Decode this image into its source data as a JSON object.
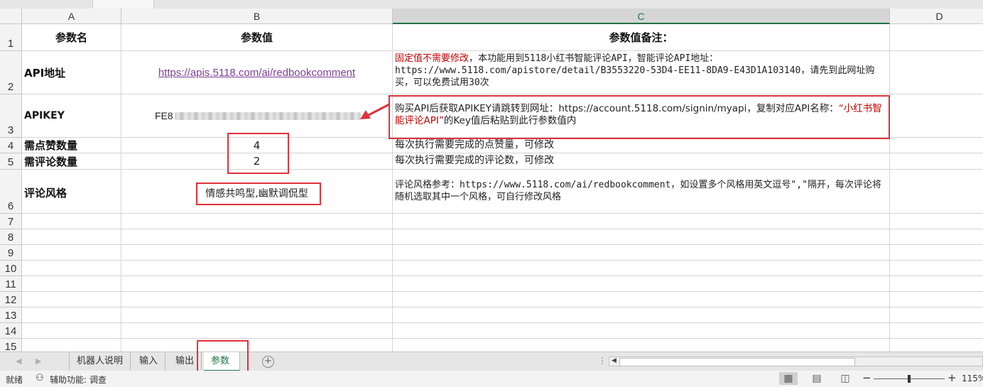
{
  "columns": [
    "A",
    "B",
    "C",
    "D"
  ],
  "rows": [
    "1",
    "2",
    "3",
    "4",
    "5",
    "6",
    "7",
    "8",
    "9",
    "10",
    "11",
    "12",
    "13",
    "14",
    "15"
  ],
  "header": {
    "name": "参数名",
    "value": "参数值",
    "note": "参数值备注："
  },
  "params": [
    {
      "name": "API地址",
      "value": "https://apis.5118.com/ai/redbookcomment",
      "note_red": "固定值不需要修改",
      "note": "，本功能用到5118小红书智能评论API，智能评论API地址：https://www.5118.com/apistore/detail/B3553220-53D4-EE11-8DA9-E43D1A103140，请先到此网址购买，可以免费试用30次"
    },
    {
      "name": "APIKEY",
      "value": "FE8",
      "note_pre": "购买API后获取APIKEY请跳转到网址：https://account.5118.com/signin/myapi，复制对应API名称：",
      "note_red": "“小红书智能评论API”",
      "note_post": "的Key值后粘贴到此行参数值内"
    },
    {
      "name": "需点赞数量",
      "value": "4",
      "note": "每次执行需要完成的点赞量，可修改"
    },
    {
      "name": "需评论数量",
      "value": "2",
      "note": "每次执行需要完成的评论数，可修改"
    },
    {
      "name": "评论风格",
      "value": "情感共鸣型,幽默调侃型",
      "note": "评论风格参考：https://www.5118.com/ai/redbookcomment，如设置多个风格用英文逗号\",\"隔开，每次评论将随机选取其中一个风格，可自行修改风格"
    }
  ],
  "sheet_tabs": [
    "机器人说明",
    "输入",
    "输出",
    "参数"
  ],
  "active_tab": "参数",
  "status": {
    "ready": "就绪",
    "accessibility": "辅助功能: 调查",
    "zoom": "115%"
  },
  "zoom_level": 115,
  "colors": {
    "accent": "#217346",
    "highlight": "#e0323b",
    "note_red": "#c00000",
    "link": "#7f3f98"
  }
}
